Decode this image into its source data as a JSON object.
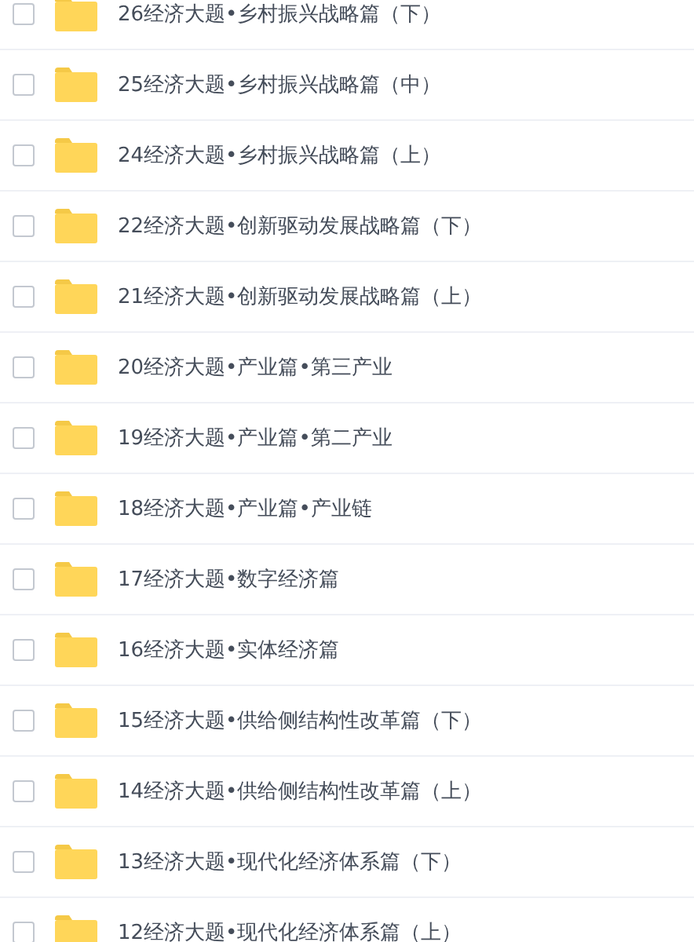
{
  "files": [
    {
      "name": "26经济大题•乡村振兴战略篇（下）",
      "checked": false
    },
    {
      "name": "25经济大题•乡村振兴战略篇（中）",
      "checked": false
    },
    {
      "name": "24经济大题•乡村振兴战略篇（上）",
      "checked": false
    },
    {
      "name": "22经济大题•创新驱动发展战略篇（下）",
      "checked": false
    },
    {
      "name": "21经济大题•创新驱动发展战略篇（上）",
      "checked": false
    },
    {
      "name": "20经济大题•产业篇•第三产业",
      "checked": false
    },
    {
      "name": "19经济大题•产业篇•第二产业",
      "checked": false
    },
    {
      "name": "18经济大题•产业篇•产业链",
      "checked": false
    },
    {
      "name": "17经济大题•数字经济篇",
      "checked": false
    },
    {
      "name": "16经济大题•实体经济篇",
      "checked": false
    },
    {
      "name": "15经济大题•供给侧结构性改革篇（下）",
      "checked": false
    },
    {
      "name": "14经济大题•供给侧结构性改革篇（上）",
      "checked": false
    },
    {
      "name": "13经济大题•现代化经济体系篇（下）",
      "checked": false
    },
    {
      "name": "12经济大题•现代化经济体系篇（上）",
      "checked": false
    }
  ]
}
